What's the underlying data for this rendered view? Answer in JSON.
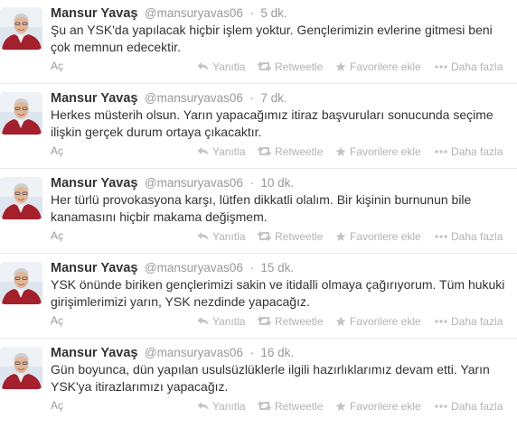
{
  "tweets": [
    {
      "fullname": "Mansur Yavaş",
      "username": "@mansuryavas06",
      "separator": "·",
      "time": "5 dk.",
      "text": "Şu an YSK'da yapılacak hiçbir işlem yoktur. Gençlerimizin evlerine gitmesi beni çok memnun edecektir.",
      "expand": "Aç"
    },
    {
      "fullname": "Mansur Yavaş",
      "username": "@mansuryavas06",
      "separator": "·",
      "time": "7 dk.",
      "text": "Herkes müsterih olsun. Yarın yapacağımız itiraz başvuruları sonucunda seçime ilişkin gerçek durum ortaya çıkacaktır.",
      "expand": "Aç"
    },
    {
      "fullname": "Mansur Yavaş",
      "username": "@mansuryavas06",
      "separator": "·",
      "time": "10 dk.",
      "text": "Her türlü provokasyona karşı, lütfen dikkatli olalım. Bir kişinin burnunun bile kanamasını hiçbir makama değişmem.",
      "expand": "Aç"
    },
    {
      "fullname": "Mansur Yavaş",
      "username": "@mansuryavas06",
      "separator": "·",
      "time": "15 dk.",
      "text": "YSK önünde biriken gençlerimizi sakin ve itidalli olmaya çağırıyorum. Tüm hukuki girişimlerimizi yarın, YSK nezdinde yapacağız.",
      "expand": "Aç"
    },
    {
      "fullname": "Mansur Yavaş",
      "username": "@mansuryavas06",
      "separator": "·",
      "time": "16 dk.",
      "text": "Gün boyunca, dün yapılan usulsüzlüklerle ilgili hazırlıklarımız devam etti. Yarın YSK'ya itirazlarımızı yapacağız.",
      "expand": "Aç"
    }
  ],
  "actions": {
    "reply": "Yanıtla",
    "retweet": "Retweetle",
    "favorite": "Favorilere ekle",
    "more": "Daha fazla"
  },
  "icons": {
    "reply": "reply-icon",
    "retweet": "retweet-icon",
    "favorite": "star-icon",
    "more": "ellipsis-icon"
  },
  "colors": {
    "text": "#333333",
    "meta": "#999999",
    "action": "#b3b3b3",
    "divider": "#e8e8e8"
  }
}
